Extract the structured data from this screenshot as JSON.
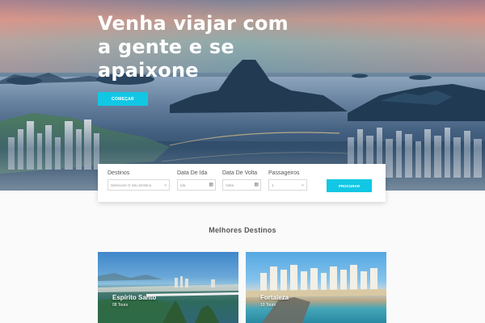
{
  "hero": {
    "title_line1": "Venha viajar com",
    "title_line2": "a gente e se",
    "title_line3": "apaixone",
    "cta_label": "COMEÇAR"
  },
  "search": {
    "destination": {
      "label": "Destinos",
      "placeholder": "Selecione O Seu Destino",
      "icon": "chevron-down-icon"
    },
    "date_out": {
      "label": "Data De Ida",
      "placeholder": "Ida",
      "icon": "calendar-icon"
    },
    "date_back": {
      "label": "Data De Volta",
      "placeholder": "Volta",
      "icon": "calendar-icon"
    },
    "passengers": {
      "label": "Passageiros",
      "value": "1",
      "icon": "chevron-down-icon"
    },
    "button_label": "PROCURAR"
  },
  "destinations": {
    "title": "Melhores Destinos",
    "items": [
      {
        "name": "Espírito Santo",
        "tours": "08 Tours"
      },
      {
        "name": "Fortaleza",
        "tours": "10 Tours"
      }
    ]
  },
  "colors": {
    "accent": "#12c7e4",
    "background": "#fafafa"
  }
}
